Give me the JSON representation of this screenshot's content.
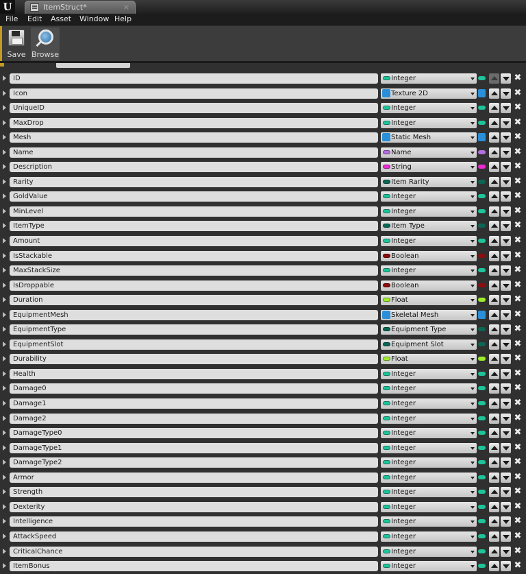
{
  "window": {
    "tab_title": "ItemStruct*",
    "tab_close": "×"
  },
  "menu": [
    "File",
    "Edit",
    "Asset",
    "Window",
    "Help"
  ],
  "toolbar": {
    "save_label": "Save",
    "browse_label": "Browse"
  },
  "type_colors": {
    "Integer": "#1fc39a",
    "Texture 2D": "#2a8fd8",
    "Static Mesh": "#2a8fd8",
    "Skeletal Mesh": "#2a8fd8",
    "Name": "#b36ee0",
    "String": "#ea2bd0",
    "Item Rarity": "#0b6655",
    "Item Type": "#0b6655",
    "Equipment Type": "#0b6655",
    "Equipment Slot": "#0b6655",
    "Boolean": "#8c0d0d",
    "Float": "#9cec2a"
  },
  "object_types": [
    "Texture 2D",
    "Static Mesh",
    "Skeletal Mesh"
  ],
  "variables": [
    {
      "name": "ID",
      "type": "Integer"
    },
    {
      "name": "Icon",
      "type": "Texture 2D"
    },
    {
      "name": "UniqueID",
      "type": "Integer"
    },
    {
      "name": "MaxDrop",
      "type": "Integer"
    },
    {
      "name": "Mesh",
      "type": "Static Mesh"
    },
    {
      "name": "Name",
      "type": "Name"
    },
    {
      "name": "Description",
      "type": "String"
    },
    {
      "name": "Rarity",
      "type": "Item Rarity"
    },
    {
      "name": "GoldValue",
      "type": "Integer"
    },
    {
      "name": "MinLevel",
      "type": "Integer"
    },
    {
      "name": "ItemType",
      "type": "Item Type"
    },
    {
      "name": "Amount",
      "type": "Integer"
    },
    {
      "name": "IsStackable",
      "type": "Boolean"
    },
    {
      "name": "MaxStackSize",
      "type": "Integer"
    },
    {
      "name": "IsDroppable",
      "type": "Boolean"
    },
    {
      "name": "Duration",
      "type": "Float"
    },
    {
      "name": "EquipmentMesh",
      "type": "Skeletal Mesh"
    },
    {
      "name": "EquipmentType",
      "type": "Equipment Type"
    },
    {
      "name": "EquipmentSlot",
      "type": "Equipment Slot"
    },
    {
      "name": "Durability",
      "type": "Float"
    },
    {
      "name": "Health",
      "type": "Integer"
    },
    {
      "name": "Damage0",
      "type": "Integer"
    },
    {
      "name": "Damage1",
      "type": "Integer"
    },
    {
      "name": "Damage2",
      "type": "Integer"
    },
    {
      "name": "DamageType0",
      "type": "Integer"
    },
    {
      "name": "DamageType1",
      "type": "Integer"
    },
    {
      "name": "DamageType2",
      "type": "Integer"
    },
    {
      "name": "Armor",
      "type": "Integer"
    },
    {
      "name": "Strength",
      "type": "Integer"
    },
    {
      "name": "Dexterity",
      "type": "Integer"
    },
    {
      "name": "Intelligence",
      "type": "Integer"
    },
    {
      "name": "AttackSpeed",
      "type": "Integer"
    },
    {
      "name": "CriticalChance",
      "type": "Integer"
    },
    {
      "name": "ItemBonus",
      "type": "Integer"
    }
  ]
}
